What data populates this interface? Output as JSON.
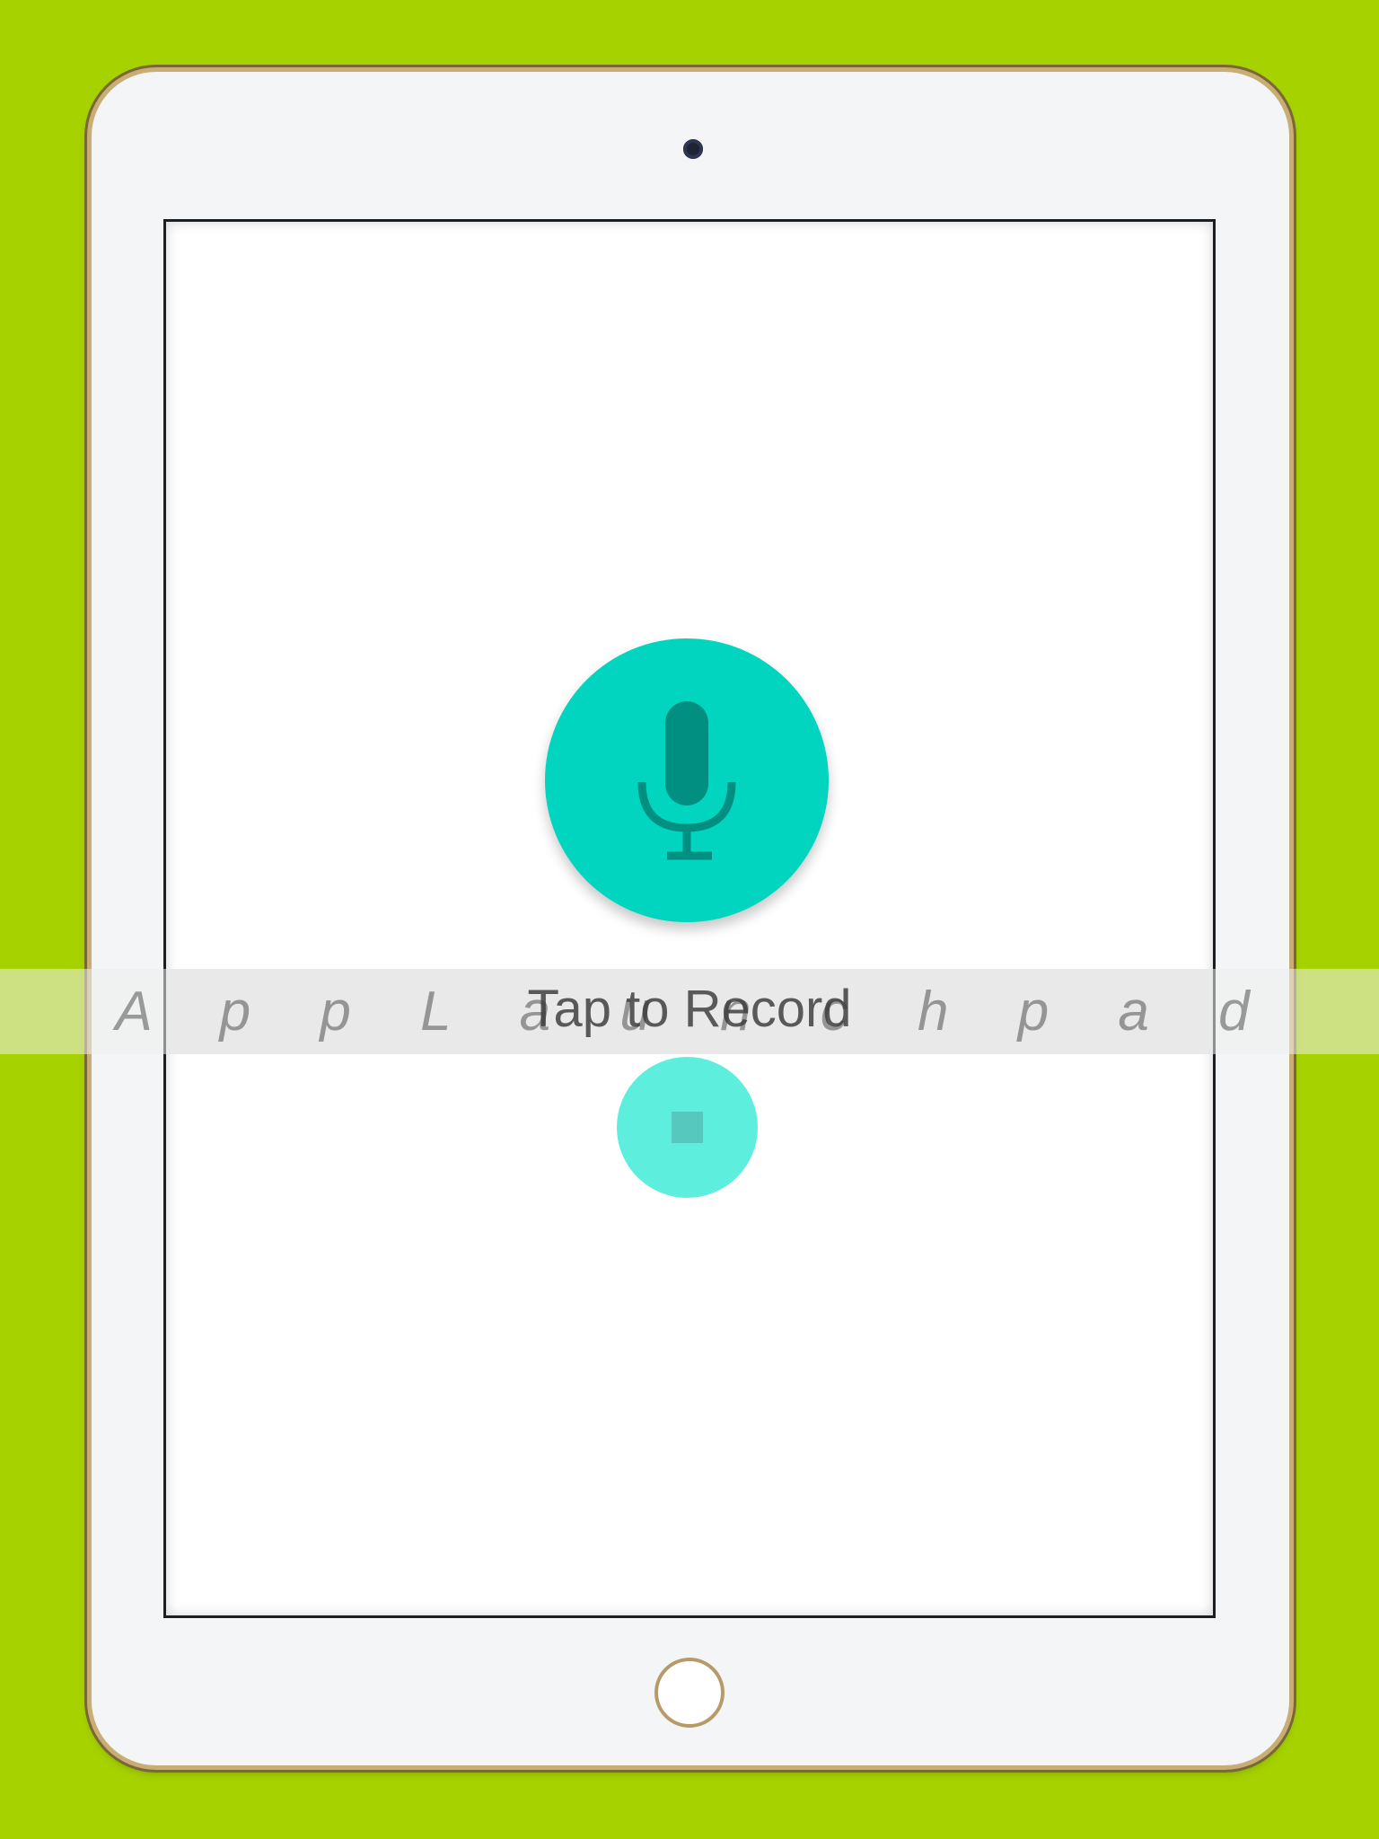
{
  "app": {
    "watermark": "A p p L a u n c h p a d",
    "record_label": "Tap to Record"
  },
  "icons": {
    "record": "microphone-icon",
    "stop": "stop-icon",
    "camera": "camera-icon",
    "home": "home-button-icon"
  },
  "colors": {
    "background": "#a6d200",
    "record_button": "#02d5bf",
    "microphone": "#008f80",
    "stop_button": "#5eeedd",
    "stop_square": "#56c8bd"
  }
}
